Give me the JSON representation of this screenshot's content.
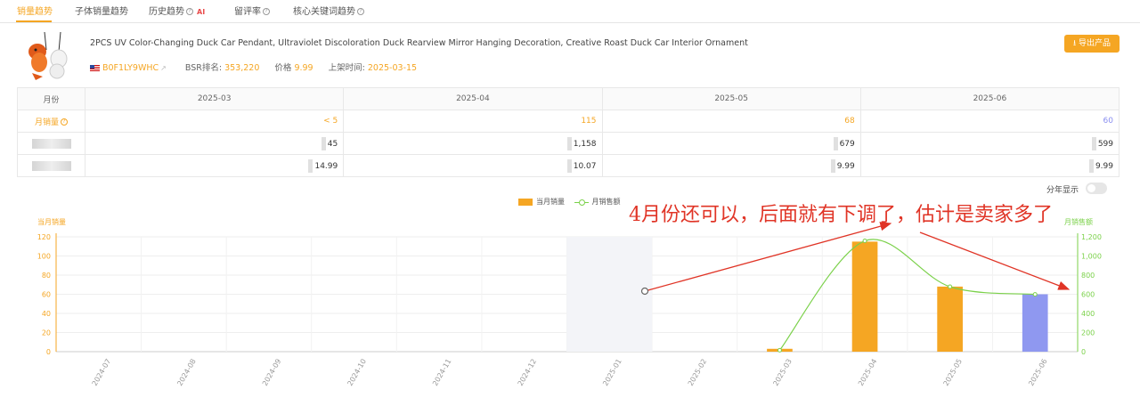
{
  "tabs": [
    {
      "label": "销量趋势",
      "active": true
    },
    {
      "label": "子体销量趋势",
      "active": false
    },
    {
      "label": "历史趋势",
      "help": true,
      "badge": "AI"
    },
    {
      "label": "留评率",
      "help": true
    },
    {
      "label": "核心关键词趋势",
      "help": true
    }
  ],
  "product": {
    "title": "2PCS UV Color-Changing Duck Car Pendant, Ultraviolet Discoloration Duck Rearview Mirror Hanging Decoration, Creative Roast Duck Car Interior Ornament",
    "asin": "B0F1LY9WHC",
    "bsr_label": "BSR排名:",
    "bsr_value": "353,220",
    "price_label": "价格",
    "price_value": "9.99",
    "launch_label": "上架时间:",
    "launch_value": "2025-03-15",
    "export_label": "导出产品"
  },
  "table": {
    "header_label": "月份",
    "months": [
      "2025-03",
      "2025-04",
      "2025-05",
      "2025-06"
    ],
    "sales_label": "月销量",
    "sales": [
      "< 5",
      "115",
      "68",
      "60"
    ],
    "revenue": [
      "45",
      "1,158",
      "679",
      "599"
    ],
    "prices": [
      "14.99",
      "10.07",
      "9.99",
      "9.99"
    ]
  },
  "toggle": {
    "label": "分年显示",
    "on": false
  },
  "annotation": "4月份还可以，后面就有下调了，估计是卖家多了",
  "colors": {
    "accent": "#f5a623",
    "line": "#7bd14a",
    "highlight": "#8f98f0",
    "annotation": "#e03426"
  },
  "chart_data": {
    "type": "bar",
    "legend": {
      "bar": "当月销量",
      "line": "月销售额"
    },
    "ylabel_left": "当月销量",
    "ylabel_right": "月销售额",
    "categories": [
      "2024-07",
      "2024-08",
      "2024-09",
      "2024-10",
      "2024-11",
      "2024-12",
      "2025-01",
      "2025-02",
      "2025-03",
      "2025-04",
      "2025-05",
      "2025-06"
    ],
    "left_ticks": [
      "0",
      "20",
      "40",
      "60",
      "80",
      "100",
      "120"
    ],
    "right_ticks": [
      "0",
      "200",
      "400",
      "600",
      "800",
      "1,000",
      "1,200"
    ],
    "ylim_left": [
      0,
      120
    ],
    "ylim_right": [
      0,
      1200
    ],
    "series": [
      {
        "name": "当月销量",
        "type": "bar",
        "values": [
          null,
          null,
          null,
          null,
          null,
          null,
          null,
          null,
          3,
          115,
          68,
          60
        ]
      },
      {
        "name": "月销售额",
        "type": "line",
        "values": [
          null,
          null,
          null,
          null,
          null,
          null,
          null,
          null,
          15,
          1158,
          679,
          599
        ]
      }
    ],
    "highlight_band": "2025-01",
    "highlight_bar": "2025-06"
  }
}
